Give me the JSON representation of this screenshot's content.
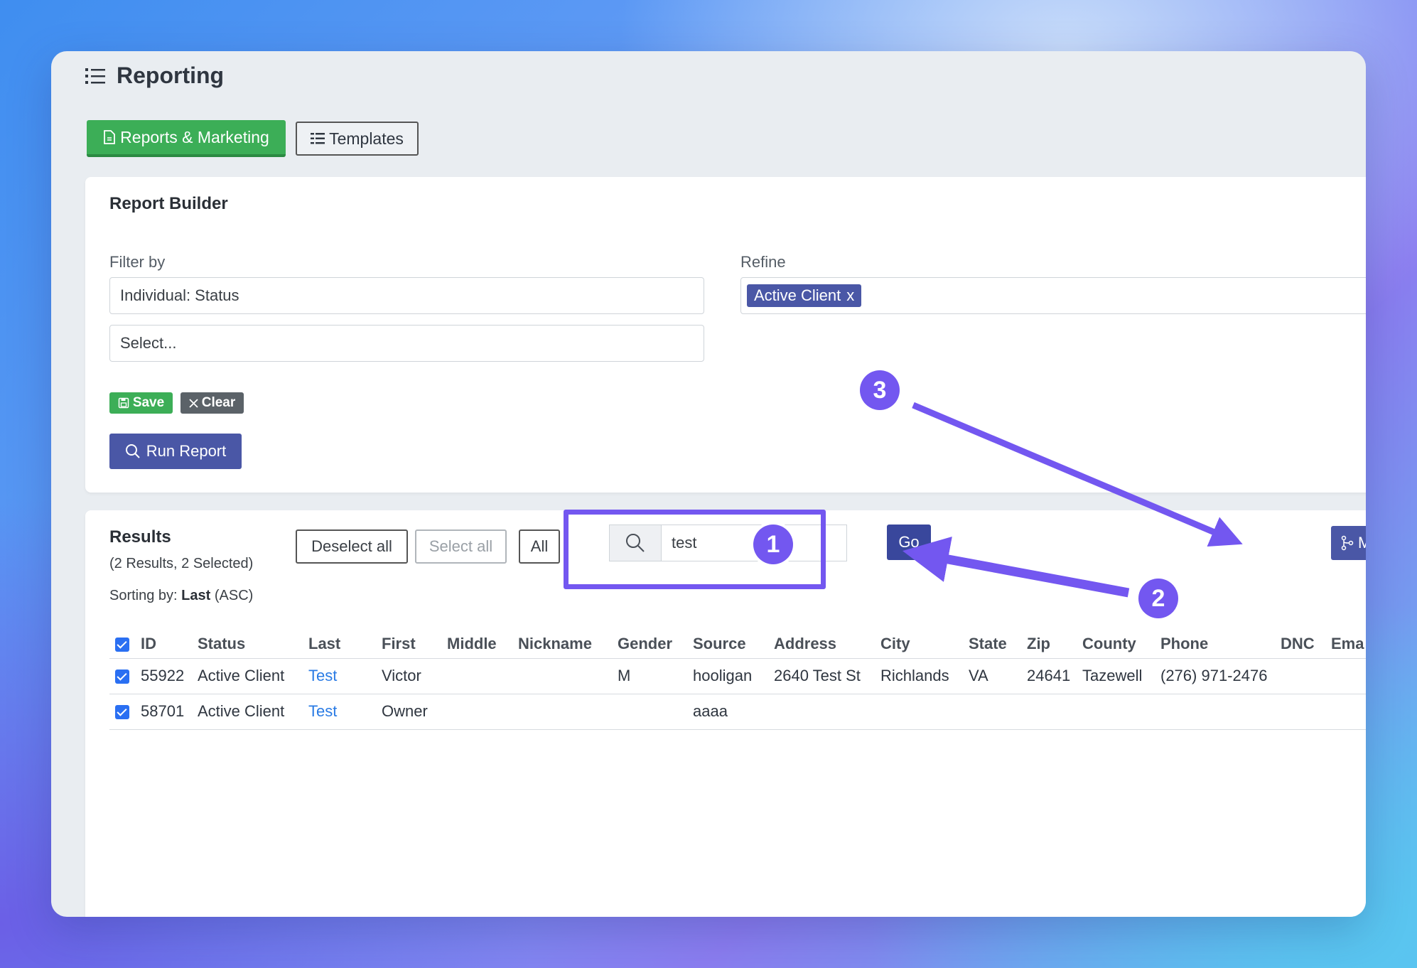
{
  "header": {
    "title": "Reporting"
  },
  "tabs": {
    "reports_marketing": "Reports & Marketing",
    "templates": "Templates"
  },
  "report_builder": {
    "title": "Report Builder",
    "filter_label": "Filter by",
    "filter_value": "Individual: Status",
    "filter_select_placeholder": "Select...",
    "refine_label": "Refine",
    "refine_chip": "Active Client",
    "refine_chip_remove": "x",
    "save_label": "Save",
    "clear_label": "Clear",
    "run_label": "Run Report"
  },
  "results": {
    "title": "Results",
    "summary": "(2 Results, 2 Selected)",
    "sorting_prefix": "Sorting by: ",
    "sorting_field": "Last",
    "sorting_order": " (ASC)",
    "deselect_all": "Deselect all",
    "select_all": "Select all",
    "all": "All",
    "search_value": "test",
    "go_label": "Go",
    "merge_label": "Merge",
    "columns": [
      "ID",
      "Status",
      "Last",
      "First",
      "Middle",
      "Nickname",
      "Gender",
      "Source",
      "Address",
      "City",
      "State",
      "Zip",
      "County",
      "Phone",
      "DNC",
      "Ema"
    ],
    "rows": [
      [
        "55922",
        "Active Client",
        "Test",
        "Victor",
        "",
        "",
        "M",
        "hooligan",
        "2640 Test St",
        "Richlands",
        "VA",
        "24641",
        "Tazewell",
        "(276) 971-2476",
        "",
        ""
      ],
      [
        "58701",
        "Active Client",
        "Test",
        "Owner",
        "",
        "",
        "",
        "aaaa",
        "",
        "",
        "",
        "",
        "",
        "",
        "",
        ""
      ]
    ]
  },
  "annotations": {
    "step1": "1",
    "step2": "2",
    "step3": "3",
    "color": "#7357f0"
  }
}
